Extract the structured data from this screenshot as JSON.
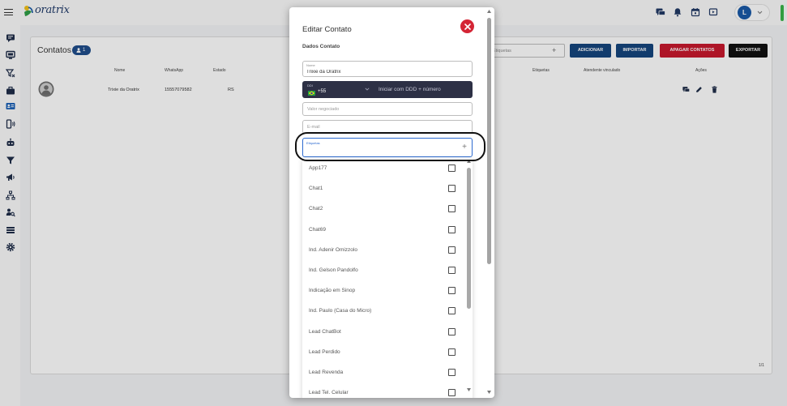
{
  "app": {
    "logo_text": "oratrix"
  },
  "topbar": {
    "icons": [
      "menu-icon",
      "chat-icon",
      "bell-icon",
      "calendar-icon",
      "screen-icon"
    ],
    "user": {
      "avatar_initial": "L"
    }
  },
  "sidebar": {
    "items": [
      {
        "icon": "inbox-icon"
      },
      {
        "icon": "dashboard-icon"
      },
      {
        "icon": "filter-off-icon"
      },
      {
        "icon": "briefcase-icon"
      },
      {
        "icon": "contact-card-icon",
        "active": true
      },
      {
        "icon": "phone-waves-icon"
      },
      {
        "icon": "robot-icon"
      },
      {
        "icon": "funnel-icon"
      },
      {
        "icon": "megaphone-icon"
      },
      {
        "icon": "sitemap-icon"
      },
      {
        "icon": "user-search-icon"
      },
      {
        "icon": "list-icon"
      },
      {
        "icon": "gear-icon"
      }
    ]
  },
  "contacts_page": {
    "title": "Contatos",
    "count_badge": "1",
    "tag_filter": {
      "placeholder": "Etiquetas",
      "add_symbol": "+"
    },
    "buttons": {
      "add": "ADICIONAR",
      "import": "IMPORTAR",
      "delete_all": "APAGAR CONTATOS",
      "export": "EXPORTAR"
    },
    "columns": [
      "Nome",
      "WhatsApp",
      "Estado",
      "Etiquetas",
      "Atendente vinculado",
      "Ações"
    ],
    "rows": [
      {
        "name": "Trixie da Oratrix",
        "whatsapp": "15557079582",
        "state": "RS",
        "actions": [
          "chat-icon",
          "pencil-icon",
          "trash-icon"
        ]
      }
    ],
    "pagination": "1/1"
  },
  "modal": {
    "title": "Editar Contato",
    "section_title": "Dados Contato",
    "name_field": {
      "label": "Nome",
      "value": "Trixie da Oratrix"
    },
    "ddi_field": {
      "label": "DDI",
      "country_icon": "brazil-flag-icon",
      "code": "+55",
      "phone_placeholder": "Iniciar com DDD + número"
    },
    "deal_value_field": {
      "placeholder": "Valor negociado"
    },
    "email_field": {
      "placeholder": "E-mail"
    },
    "tags_field": {
      "label": "Etiquetas",
      "add_symbol": "+"
    },
    "tag_options": [
      {
        "label": "App177",
        "checked": false
      },
      {
        "label": "Chat1",
        "checked": false
      },
      {
        "label": "Chat2",
        "checked": false
      },
      {
        "label": "Chat69",
        "checked": false
      },
      {
        "label": "Ind. Adenir Omizzolo",
        "checked": false
      },
      {
        "label": "Ind. Gelson Pandolfo",
        "checked": false
      },
      {
        "label": "Indicação em Sinop",
        "checked": false
      },
      {
        "label": "Ind. Paulo (Casa do Micro)",
        "checked": false
      },
      {
        "label": "Lead ChatBot",
        "checked": false
      },
      {
        "label": "Lead Perdido",
        "checked": false
      },
      {
        "label": "Lead Revenda",
        "checked": false
      },
      {
        "label": "Lead Tel. Celular",
        "checked": false
      }
    ]
  },
  "colors": {
    "primary": "#15457e",
    "danger": "#c8192d",
    "export": "#111111",
    "close": "#d42535",
    "ddi_background": "#2d3045",
    "focus": "#2d6bd0",
    "status": "#3ab54a",
    "sidebar_active": "#1d63b8"
  }
}
